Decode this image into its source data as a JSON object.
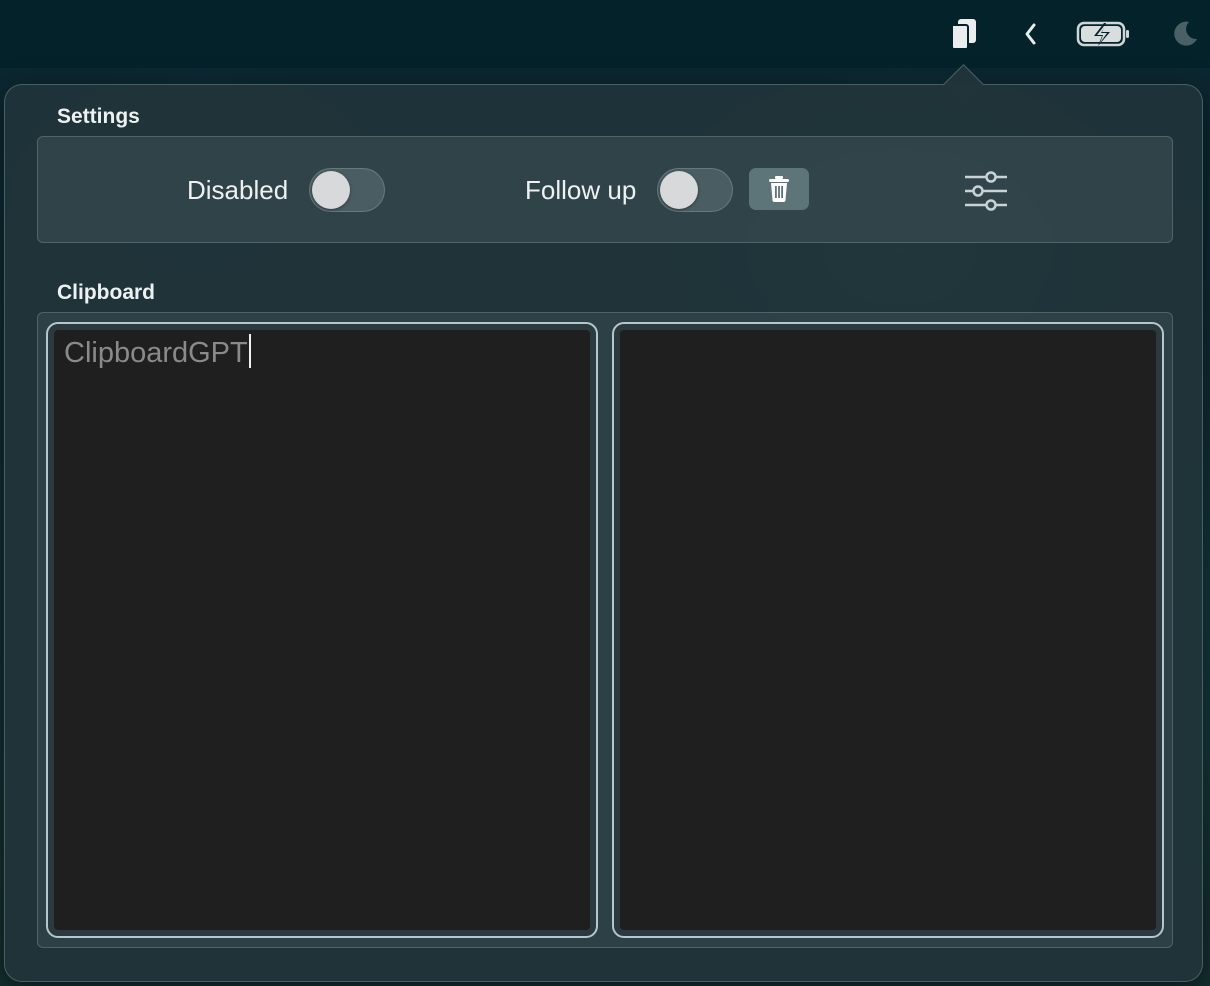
{
  "menubar": {
    "icons": [
      "clipboard-icon",
      "chevron-left-icon",
      "battery-charging-icon",
      "moon-icon"
    ]
  },
  "popover": {
    "settings": {
      "title": "Settings",
      "disabled_label": "Disabled",
      "disabled_on": false,
      "followup_label": "Follow up",
      "followup_on": false,
      "delete_icon": "trash-icon",
      "options_icon": "sliders-icon"
    },
    "clipboard": {
      "title": "Clipboard",
      "input_text": "ClipboardGPT",
      "output_text": ""
    }
  },
  "colors": {
    "menubar": "#04222a",
    "popover": "#21343a",
    "pane": "#1f1f1f",
    "pane_border": "#b5c7cc",
    "trash_button": "#5d7479"
  }
}
